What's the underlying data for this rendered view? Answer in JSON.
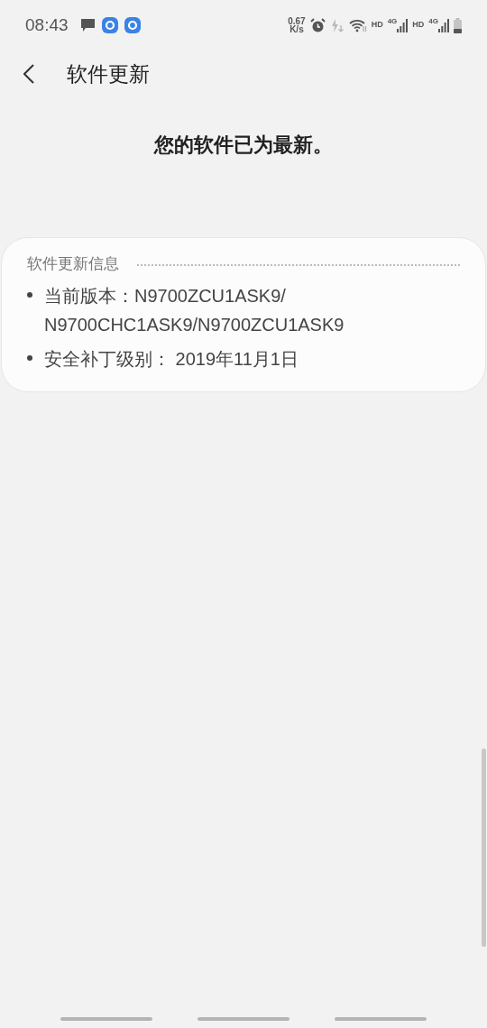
{
  "status_bar": {
    "time": "08:43",
    "speed": [
      "0.67",
      "K/s"
    ],
    "network": [
      {
        "label": "HD",
        "type": "4G"
      },
      {
        "label": "HD",
        "type": "4G"
      }
    ]
  },
  "header": {
    "title": "软件更新"
  },
  "message": "您的软件已为最新。",
  "info_card": {
    "title": "软件更新信息",
    "items": [
      {
        "text": "当前版本：N9700ZCU1ASK9/\nN9700CHC1ASK9/N9700ZCU1ASK9"
      },
      {
        "text": "安全补丁级别： 2019年11月1日"
      }
    ]
  }
}
